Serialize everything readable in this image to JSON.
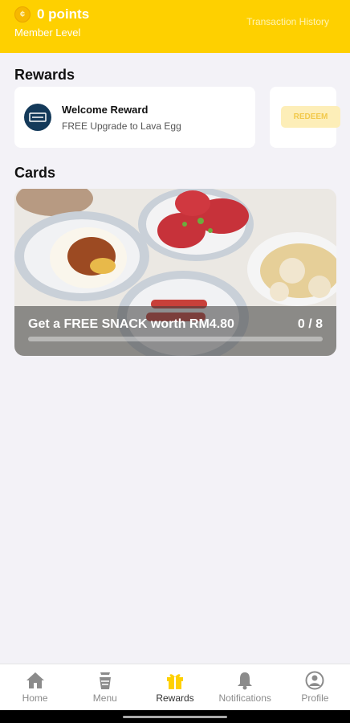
{
  "header": {
    "points": "0 points",
    "member_level": "Member Level",
    "transaction_history": "Transaction History"
  },
  "rewards": {
    "section_title": "Rewards",
    "items": [
      {
        "title": "Welcome Reward",
        "description": "FREE Upgrade to Lava Egg",
        "redeem_label": "REDEEM",
        "icon": "voucher-icon"
      }
    ]
  },
  "cards": {
    "section_title": "Cards",
    "items": [
      {
        "title": "Get a FREE SNACK worth RM4.80",
        "progress_label": "0 / 8",
        "progress_value": 0,
        "progress_total": 8,
        "image": "food-photo"
      }
    ]
  },
  "tabbar": {
    "tabs": [
      {
        "label": "Home",
        "icon": "home-icon",
        "active": false
      },
      {
        "label": "Menu",
        "icon": "menu-icon",
        "active": false
      },
      {
        "label": "Rewards",
        "icon": "gift-icon",
        "active": true
      },
      {
        "label": "Notifications",
        "icon": "bell-icon",
        "active": false
      },
      {
        "label": "Profile",
        "icon": "profile-icon",
        "active": false
      }
    ]
  },
  "colors": {
    "brand_yellow": "#fed000",
    "background": "#f3f2f7",
    "inactive_tab": "#8b8b8b"
  }
}
